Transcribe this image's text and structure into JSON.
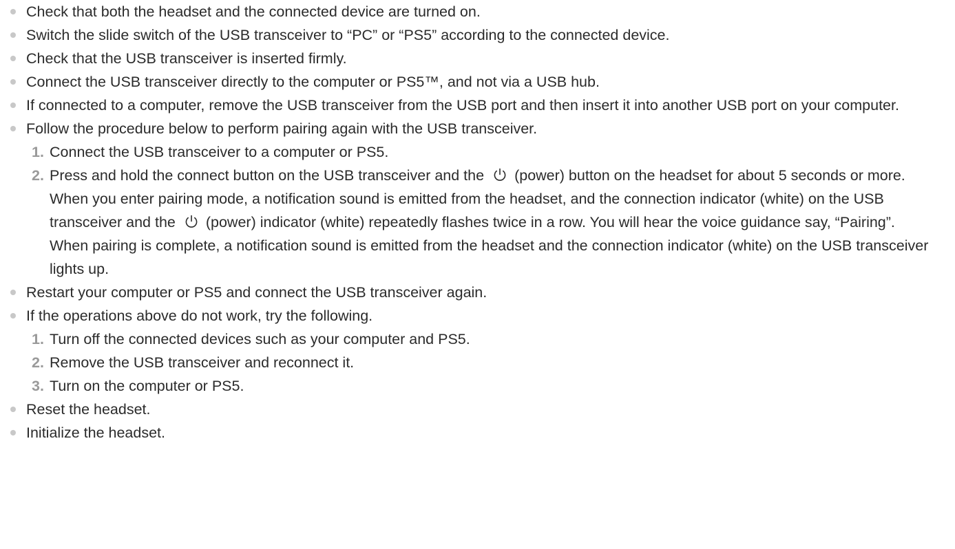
{
  "items": [
    {
      "text": "Check that both the headset and the connected device are turned on."
    },
    {
      "text": "Switch the slide switch of the USB transceiver to “PC” or “PS5” according to the connected device."
    },
    {
      "text": "Check that the USB transceiver is inserted firmly."
    },
    {
      "text": "Connect the USB transceiver directly to the computer or PS5™, and not via a USB hub."
    },
    {
      "text": "If connected to a computer, remove the USB transceiver from the USB port and then insert it into another USB port on your computer."
    },
    {
      "text": "Follow the procedure below to perform pairing again with the USB transceiver.",
      "steps": [
        {
          "num": "1.",
          "text": "Connect the USB transceiver to a computer or PS5."
        },
        {
          "num": "2.",
          "text_a": "Press and hold the connect button on the USB transceiver and the",
          "text_b": "(power) button on the headset for about 5 seconds or more.",
          "para2_a": "When you enter pairing mode, a notification sound is emitted from the headset, and the connection indicator (white) on the USB transceiver and the",
          "para2_b": "(power) indicator (white) repeatedly flashes twice in a row. You will hear the voice guidance say, “Pairing”.",
          "para3": "When pairing is complete, a notification sound is emitted from the headset and the connection indicator (white) on the USB transceiver lights up."
        }
      ]
    },
    {
      "text": "Restart your computer or PS5 and connect the USB transceiver again."
    },
    {
      "text": "If the operations above do not work, try the following.",
      "steps": [
        {
          "num": "1.",
          "text": "Turn off the connected devices such as your computer and PS5."
        },
        {
          "num": "2.",
          "text": "Remove the USB transceiver and reconnect it."
        },
        {
          "num": "3.",
          "text": "Turn on the computer or PS5."
        }
      ]
    },
    {
      "text": "Reset the headset."
    },
    {
      "text": "Initialize the headset."
    }
  ],
  "icons": {
    "power": "power-icon"
  },
  "colors": {
    "text": "#2b2b2b",
    "bullet": "#c8c8c8",
    "step_number": "#9a9a9a"
  }
}
